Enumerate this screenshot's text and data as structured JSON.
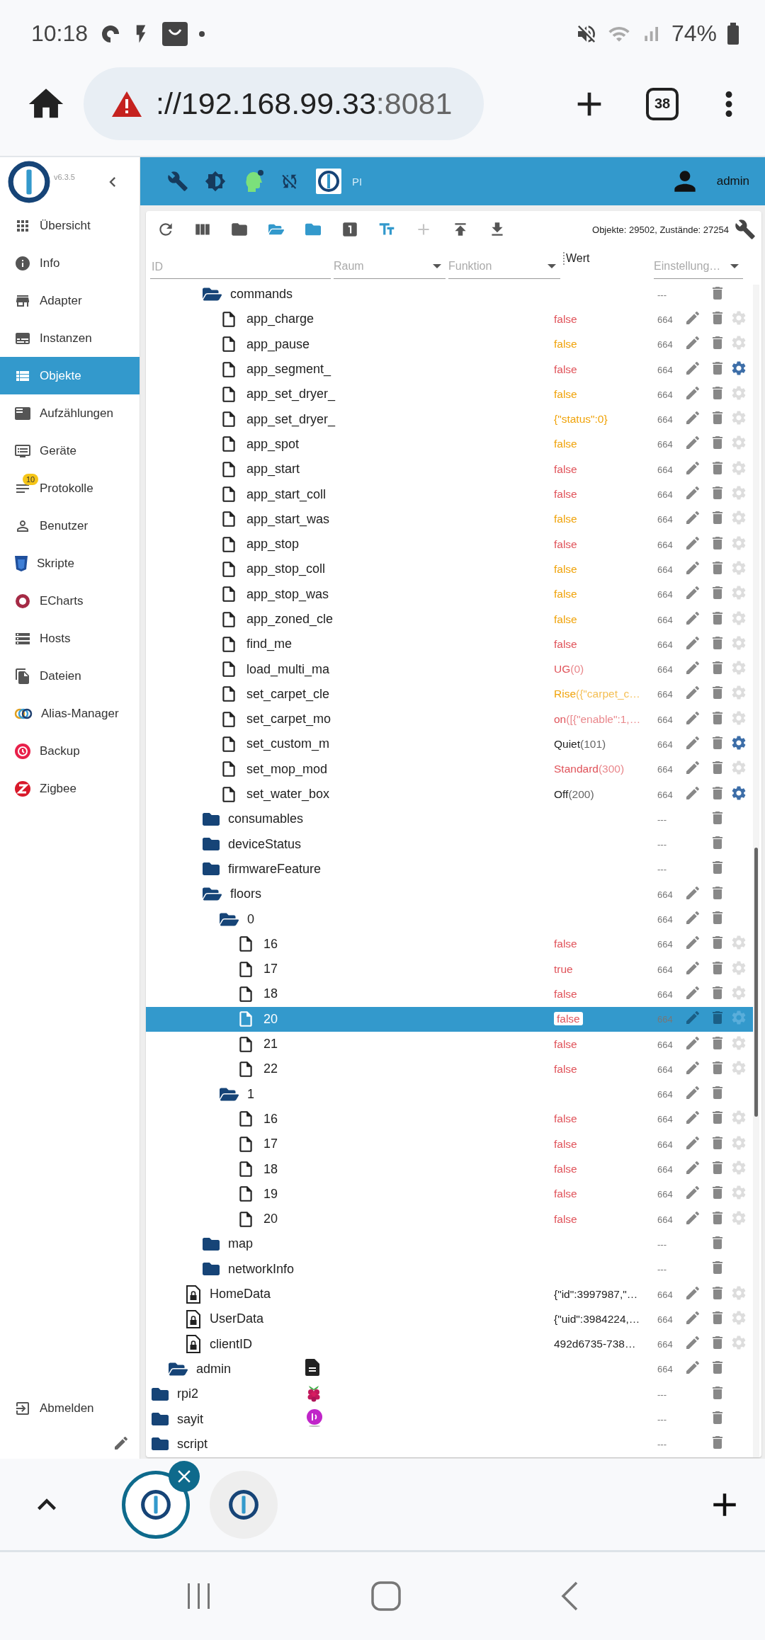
{
  "status_bar": {
    "time": "10:18",
    "battery": "74%"
  },
  "browser": {
    "url_host": "://192.168.99.33",
    "url_port": ":8081",
    "tab_count": "38"
  },
  "sidebar": {
    "version": "v6.3.5",
    "items": [
      {
        "label": "Übersicht",
        "selected": false
      },
      {
        "label": "Info",
        "selected": false
      },
      {
        "label": "Adapter",
        "selected": false
      },
      {
        "label": "Instanzen",
        "selected": false
      },
      {
        "label": "Objekte",
        "selected": true
      },
      {
        "label": "Aufzählungen",
        "selected": false
      },
      {
        "label": "Geräte",
        "selected": false
      },
      {
        "label": "Protokolle",
        "selected": false,
        "badge": "10"
      },
      {
        "label": "Benutzer",
        "selected": false
      },
      {
        "label": "Skripte",
        "selected": false
      },
      {
        "label": "ECharts",
        "selected": false
      },
      {
        "label": "Hosts",
        "selected": false
      },
      {
        "label": "Dateien",
        "selected": false
      },
      {
        "label": "Alias-Manager",
        "selected": false
      },
      {
        "label": "Backup",
        "selected": false
      },
      {
        "label": "Zigbee",
        "selected": false
      }
    ],
    "logout": "Abmelden"
  },
  "header": {
    "instance": "PI",
    "user": "admin"
  },
  "toolbar": {
    "buttons": [
      {
        "kind": "refresh",
        "disabled": false,
        "highlighted": false
      },
      {
        "kind": "columns",
        "disabled": false,
        "highlighted": false
      },
      {
        "kind": "closed",
        "disabled": false,
        "highlighted": false
      },
      {
        "kind": "opened",
        "disabled": false,
        "highlighted": true
      },
      {
        "kind": "folded",
        "disabled": false,
        "highlighted": true
      },
      {
        "kind": "number",
        "disabled": false,
        "highlighted": false
      },
      {
        "kind": "textsize",
        "disabled": false,
        "highlighted": true
      },
      {
        "kind": "add",
        "disabled": true,
        "highlighted": false
      },
      {
        "kind": "upload",
        "disabled": false,
        "highlighted": false
      },
      {
        "kind": "download",
        "disabled": false,
        "highlighted": false
      }
    ],
    "stats": "Objekte: 29502, Zustände: 27254"
  },
  "filters": {
    "id_placeholder": "ID",
    "room": "Raum",
    "function": "Funktion",
    "value_header": "Wert",
    "settings": "Einstellung…"
  },
  "tree": [
    {
      "children": [
        {
          "children": [
            {
              "children": [
                {
                  "name": "commands",
                  "kind": "folder",
                  "expanded": true,
                  "acl": "---",
                  "editable": false,
                  "selected": false,
                  "children": [
                    {
                      "name": "app_charge",
                      "kind": "state",
                      "value": {
                        "text": "false",
                        "color": "#e0535a"
                      },
                      "acl": "664",
                      "editable": true,
                      "custom": false,
                      "selected": false
                    },
                    {
                      "name": "app_pause",
                      "kind": "state",
                      "value": {
                        "text": "false",
                        "color": "#f0a30a"
                      },
                      "acl": "664",
                      "editable": true,
                      "custom": false,
                      "selected": false
                    },
                    {
                      "name": "app_segment_",
                      "kind": "state",
                      "value": {
                        "text": "false",
                        "color": "#e0535a"
                      },
                      "acl": "664",
                      "editable": true,
                      "custom": true,
                      "selected": false
                    },
                    {
                      "name": "app_set_dryer_",
                      "kind": "state",
                      "value": {
                        "text": "false",
                        "color": "#f0a30a"
                      },
                      "acl": "664",
                      "editable": true,
                      "custom": false,
                      "selected": false
                    },
                    {
                      "name": "app_set_dryer_",
                      "kind": "state",
                      "value": {
                        "text": "{\"status\":0}",
                        "color": "#f0a30a"
                      },
                      "acl": "664",
                      "editable": true,
                      "custom": false,
                      "selected": false
                    },
                    {
                      "name": "app_spot",
                      "kind": "state",
                      "value": {
                        "text": "false",
                        "color": "#f0a30a"
                      },
                      "acl": "664",
                      "editable": true,
                      "custom": false,
                      "selected": false
                    },
                    {
                      "name": "app_start",
                      "kind": "state",
                      "value": {
                        "text": "false",
                        "color": "#e0535a"
                      },
                      "acl": "664",
                      "editable": true,
                      "custom": false,
                      "selected": false
                    },
                    {
                      "name": "app_start_coll",
                      "kind": "state",
                      "value": {
                        "text": "false",
                        "color": "#e0535a"
                      },
                      "acl": "664",
                      "editable": true,
                      "custom": false,
                      "selected": false
                    },
                    {
                      "name": "app_start_was",
                      "kind": "state",
                      "value": {
                        "text": "false",
                        "color": "#f0a30a"
                      },
                      "acl": "664",
                      "editable": true,
                      "custom": false,
                      "selected": false
                    },
                    {
                      "name": "app_stop",
                      "kind": "state",
                      "value": {
                        "text": "false",
                        "color": "#e0535a"
                      },
                      "acl": "664",
                      "editable": true,
                      "custom": false,
                      "selected": false
                    },
                    {
                      "name": "app_stop_coll",
                      "kind": "state",
                      "value": {
                        "text": "false",
                        "color": "#f0a30a"
                      },
                      "acl": "664",
                      "editable": true,
                      "custom": false,
                      "selected": false
                    },
                    {
                      "name": "app_stop_was",
                      "kind": "state",
                      "value": {
                        "text": "false",
                        "color": "#f0a30a"
                      },
                      "acl": "664",
                      "editable": true,
                      "custom": false,
                      "selected": false
                    },
                    {
                      "name": "app_zoned_cle",
                      "kind": "state",
                      "value": {
                        "text": "false",
                        "color": "#f0a30a"
                      },
                      "acl": "664",
                      "editable": true,
                      "custom": false,
                      "selected": false
                    },
                    {
                      "name": "find_me",
                      "kind": "state",
                      "value": {
                        "text": "false",
                        "color": "#e0535a"
                      },
                      "acl": "664",
                      "editable": true,
                      "custom": false,
                      "selected": false
                    },
                    {
                      "name": "load_multi_ma",
                      "kind": "state",
                      "value": {
                        "text": "UG",
                        "suffix": "(0)",
                        "color": "#e0535a"
                      },
                      "acl": "664",
                      "editable": true,
                      "custom": false,
                      "selected": false
                    },
                    {
                      "name": "set_carpet_cle",
                      "kind": "state",
                      "value": {
                        "text": "Rise",
                        "suffix": "({\"carpet_c…",
                        "color": "#f0a30a"
                      },
                      "acl": "664",
                      "editable": true,
                      "custom": false,
                      "selected": false
                    },
                    {
                      "name": "set_carpet_mo",
                      "kind": "state",
                      "value": {
                        "text": "on",
                        "suffix": "([{\"enable\":1,…",
                        "color": "#e0535a"
                      },
                      "acl": "664",
                      "editable": true,
                      "custom": false,
                      "selected": false
                    },
                    {
                      "name": "set_custom_m",
                      "kind": "state",
                      "value": {
                        "text": "Quiet",
                        "suffix": "(101)",
                        "color": "#222222"
                      },
                      "acl": "664",
                      "editable": true,
                      "custom": true,
                      "selected": false
                    },
                    {
                      "name": "set_mop_mod",
                      "kind": "state",
                      "value": {
                        "text": "Standard",
                        "suffix": "(300)",
                        "color": "#e0535a"
                      },
                      "acl": "664",
                      "editable": true,
                      "custom": false,
                      "selected": false
                    },
                    {
                      "name": "set_water_box",
                      "kind": "state",
                      "value": {
                        "text": "Off",
                        "suffix": "(200)",
                        "color": "#222222"
                      },
                      "acl": "664",
                      "editable": true,
                      "custom": true,
                      "selected": false
                    }
                  ]
                },
                {
                  "name": "consumables",
                  "kind": "folder",
                  "expanded": false,
                  "acl": "---",
                  "editable": false,
                  "selected": false
                },
                {
                  "name": "deviceStatus",
                  "kind": "folder",
                  "expanded": false,
                  "acl": "---",
                  "editable": false,
                  "selected": false
                },
                {
                  "name": "firmwareFeature",
                  "kind": "folder",
                  "expanded": false,
                  "acl": "---",
                  "editable": false,
                  "selected": false
                },
                {
                  "name": "floors",
                  "kind": "folder",
                  "expanded": true,
                  "acl": "664",
                  "editable": true,
                  "selected": false,
                  "children": [
                    {
                      "name": "0",
                      "kind": "folder",
                      "expanded": true,
                      "acl": "664",
                      "editable": true,
                      "selected": false,
                      "children": [
                        {
                          "name": "16",
                          "kind": "state",
                          "value": {
                            "text": "false",
                            "color": "#e0535a"
                          },
                          "acl": "664",
                          "editable": true,
                          "custom": false,
                          "selected": false
                        },
                        {
                          "name": "17",
                          "kind": "state",
                          "value": {
                            "text": "true",
                            "color": "#e0535a"
                          },
                          "acl": "664",
                          "editable": true,
                          "custom": false,
                          "selected": false
                        },
                        {
                          "name": "18",
                          "kind": "state",
                          "value": {
                            "text": "false",
                            "color": "#e0535a"
                          },
                          "acl": "664",
                          "editable": true,
                          "custom": false,
                          "selected": false
                        },
                        {
                          "name": "20",
                          "kind": "state",
                          "value": {
                            "text": "false",
                            "color": "#e0535a"
                          },
                          "acl": "664",
                          "editable": true,
                          "custom": false,
                          "selected": true
                        },
                        {
                          "name": "21",
                          "kind": "state",
                          "value": {
                            "text": "false",
                            "color": "#e0535a"
                          },
                          "acl": "664",
                          "editable": true,
                          "custom": false,
                          "selected": false
                        },
                        {
                          "name": "22",
                          "kind": "state",
                          "value": {
                            "text": "false",
                            "color": "#e0535a"
                          },
                          "acl": "664",
                          "editable": true,
                          "custom": false,
                          "selected": false
                        }
                      ]
                    },
                    {
                      "name": "1",
                      "kind": "folder",
                      "expanded": true,
                      "acl": "664",
                      "editable": true,
                      "selected": false,
                      "children": [
                        {
                          "name": "16",
                          "kind": "state",
                          "value": {
                            "text": "false",
                            "color": "#e0535a"
                          },
                          "acl": "664",
                          "editable": true,
                          "custom": false,
                          "selected": false
                        },
                        {
                          "name": "17",
                          "kind": "state",
                          "value": {
                            "text": "false",
                            "color": "#e0535a"
                          },
                          "acl": "664",
                          "editable": true,
                          "custom": false,
                          "selected": false
                        },
                        {
                          "name": "18",
                          "kind": "state",
                          "value": {
                            "text": "false",
                            "color": "#e0535a"
                          },
                          "acl": "664",
                          "editable": true,
                          "custom": false,
                          "selected": false
                        },
                        {
                          "name": "19",
                          "kind": "state",
                          "value": {
                            "text": "false",
                            "color": "#e0535a"
                          },
                          "acl": "664",
                          "editable": true,
                          "custom": false,
                          "selected": false
                        },
                        {
                          "name": "20",
                          "kind": "state",
                          "value": {
                            "text": "false",
                            "color": "#e0535a"
                          },
                          "acl": "664",
                          "editable": true,
                          "custom": false,
                          "selected": false
                        }
                      ]
                    }
                  ]
                },
                {
                  "name": "map",
                  "kind": "folder",
                  "expanded": false,
                  "acl": "---",
                  "editable": false,
                  "selected": false
                },
                {
                  "name": "networkInfo",
                  "kind": "folder",
                  "expanded": false,
                  "acl": "---",
                  "editable": false,
                  "selected": false
                }
              ]
            },
            {
              "name": "HomeData",
              "kind": "locked",
              "value": {
                "text": "{\"id\":3997987,\"…",
                "color": "#222222"
              },
              "acl": "664",
              "editable": true,
              "custom": false,
              "selected": false
            },
            {
              "name": "UserData",
              "kind": "locked",
              "value": {
                "text": "{\"uid\":3984224,…",
                "color": "#222222"
              },
              "acl": "664",
              "editable": true,
              "custom": false,
              "selected": false
            },
            {
              "name": "clientID",
              "kind": "locked",
              "value": {
                "text": "492d6735-738…",
                "color": "#222222"
              },
              "acl": "664",
              "editable": true,
              "custom": false,
              "selected": false
            }
          ]
        },
        {
          "name": "admin",
          "kind": "folder",
          "expanded": true,
          "adapter": {
            "kind": "doc"
          },
          "acl": "664",
          "editable": true,
          "selected": false
        }
      ]
    },
    {
      "name": "rpi2",
      "kind": "folder",
      "expanded": false,
      "adapter": {
        "kind": "berry"
      },
      "acl": "---",
      "editable": false,
      "selected": false
    },
    {
      "name": "sayit",
      "kind": "folder",
      "expanded": false,
      "adapter": {
        "kind": "orb"
      },
      "acl": "---",
      "editable": false,
      "selected": false
    },
    {
      "name": "script",
      "kind": "folder",
      "expanded": false,
      "acl": "---",
      "editable": false,
      "selected": false
    }
  ],
  "browser_tabs": [
    {
      "selected": true
    },
    {
      "selected": false
    }
  ]
}
